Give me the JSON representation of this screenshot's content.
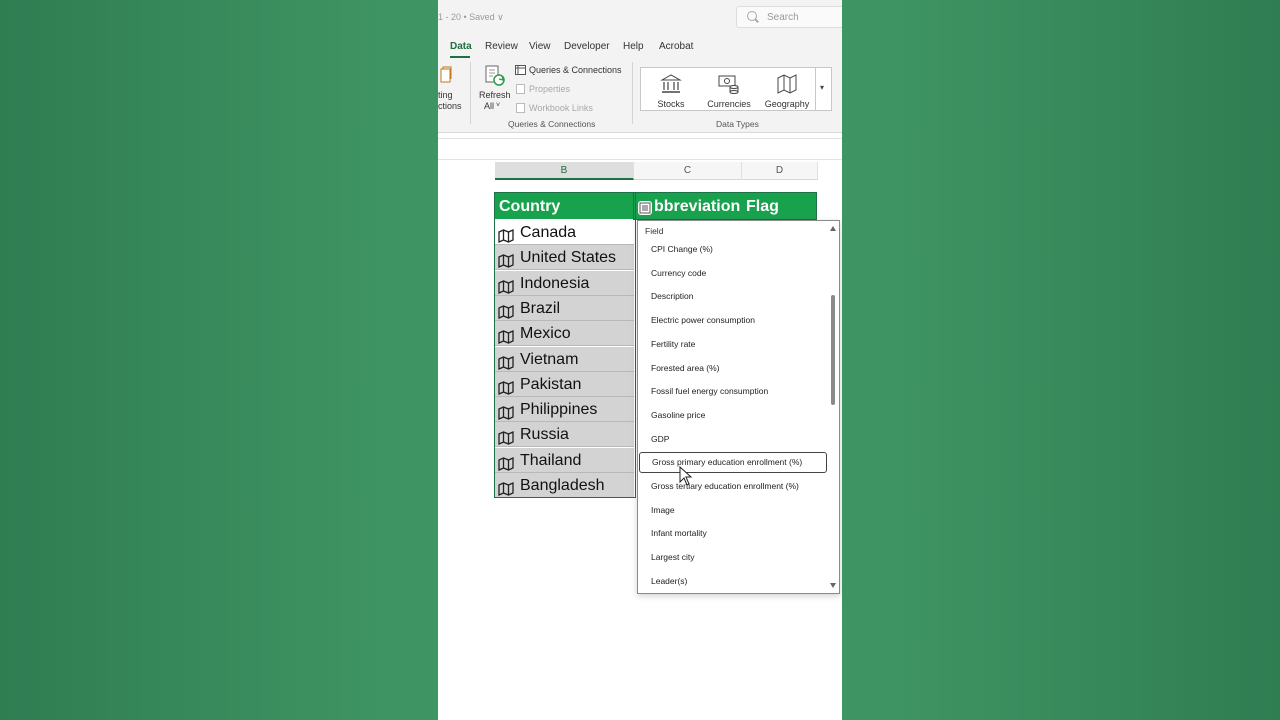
{
  "title_bar": {
    "doc_title": "1 - 20 • Saved ∨",
    "search_placeholder": "Search"
  },
  "ribbon_tabs": [
    {
      "label": "Data",
      "active": true
    },
    {
      "label": "Review"
    },
    {
      "label": "View"
    },
    {
      "label": "Developer"
    },
    {
      "label": "Help"
    },
    {
      "label": "Acrobat"
    }
  ],
  "ribbon": {
    "partial_label_1": "ting",
    "partial_label_2": "ctions",
    "refresh_label": "Refresh",
    "refresh_all_label": "All",
    "queries_connections": "Queries & Connections",
    "properties": "Properties",
    "workbook_links": "Workbook Links",
    "group_queries": "Queries & Connections",
    "group_datatypes": "Data Types",
    "datatypes": [
      {
        "label": "Stocks",
        "icon": "bank-icon"
      },
      {
        "label": "Currencies",
        "icon": "currency-icon"
      },
      {
        "label": "Geography",
        "icon": "map-icon"
      }
    ]
  },
  "columns": [
    "B",
    "C",
    "D"
  ],
  "table": {
    "headers": [
      "Country",
      "bbreviation",
      "Flag"
    ],
    "rows": [
      "Canada",
      "United States",
      "Indonesia",
      "Brazil",
      "Mexico",
      "Vietnam",
      "Pakistan",
      "Philippines",
      "Russia",
      "Thailand",
      "Bangladesh"
    ]
  },
  "field_dropdown": {
    "header": "Field",
    "items": [
      "CPI Change (%)",
      "Currency code",
      "Description",
      "Electric power consumption",
      "Fertility rate",
      "Forested area (%)",
      "Fossil fuel energy consumption",
      "Gasoline price",
      "GDP",
      "Gross primary education enrollment (%)",
      "Gross tertiary education enrollment (%)",
      "Image",
      "Infant mortality",
      "Largest city",
      "Leader(s)"
    ],
    "hovered_index": 9
  },
  "colors": {
    "accent": "#1e7145",
    "header_fill": "#19a24e",
    "background": "#3f9463"
  }
}
